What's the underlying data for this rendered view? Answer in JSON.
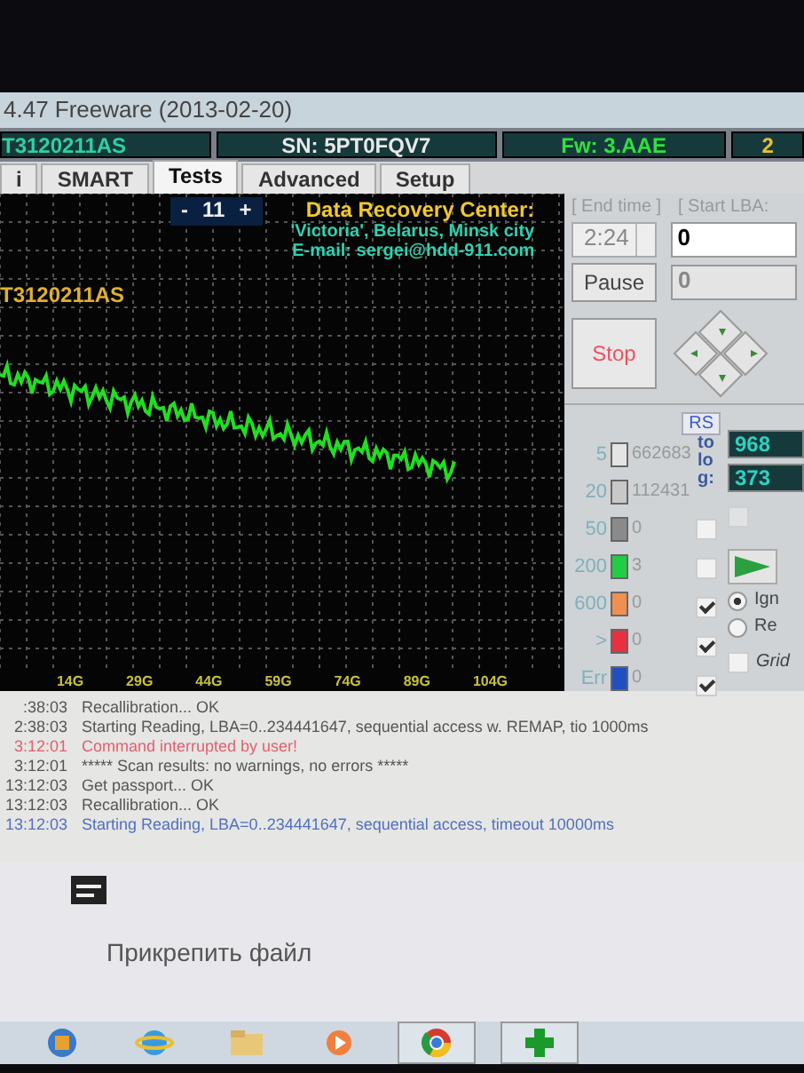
{
  "window": {
    "title": "4.47 Freeware (2013-02-20)"
  },
  "info_bar": [
    {
      "text": "T3120211AS",
      "kind": "model"
    },
    {
      "text": "SN: 5PT0FQV7",
      "kind": "serial"
    },
    {
      "text": "Fw: 3.AAE",
      "kind": "firmware"
    },
    {
      "text": "2",
      "kind": "capacity"
    }
  ],
  "tabs": [
    {
      "label": "i",
      "selected": false
    },
    {
      "label": "SMART",
      "selected": false
    },
    {
      "label": "Tests",
      "selected": true
    },
    {
      "label": "Advanced",
      "selected": false
    },
    {
      "label": "Setup",
      "selected": false
    }
  ],
  "graph": {
    "minus": "-",
    "counter": "11",
    "plus": "+",
    "credit_title": "Data Recovery Center:",
    "credit_lines": [
      "'Victoria', Belarus, Minsk city",
      "E-mail: sergei@hdd-911.com"
    ],
    "drive_label": "T3120211AS",
    "x_labels": [
      "14G",
      "29G",
      "44G",
      "59G",
      "74G",
      "89G",
      "104G"
    ]
  },
  "controls": {
    "end_time_label": "[ End time ]",
    "start_lba_label": "[ Start LBA:",
    "end_time": "2:24",
    "start_lba": "0",
    "pause": "Pause",
    "field_2": "0",
    "stop": "Stop"
  },
  "stats": {
    "rs": "RS",
    "to_log": "to log:",
    "blocks": [
      {
        "label": "5",
        "count": "662683",
        "color": "#e4e4e4"
      },
      {
        "label": "20",
        "count": "112431",
        "color": "#c8c8c8"
      },
      {
        "label": "50",
        "count": "0",
        "color": "#8a8a8a"
      },
      {
        "label": "200",
        "count": "3",
        "color": "#22cc44"
      },
      {
        "label": "600",
        "count": "0",
        "color": "#f09050"
      },
      {
        "label": ">",
        "count": "0",
        "color": "#e83040"
      },
      {
        "label": "Err",
        "count": "0",
        "color": "#2050c0"
      }
    ],
    "log_checks": [
      {
        "checked": false
      },
      {
        "checked": false
      },
      {
        "checked": true
      },
      {
        "checked": true
      },
      {
        "checked": true
      }
    ]
  },
  "side": {
    "readouts": [
      "968",
      "373"
    ],
    "option": {
      "checked": false,
      "disabled": true
    },
    "radios": [
      {
        "label": "Ign",
        "selected": true
      },
      {
        "label": "Re",
        "selected": false
      }
    ],
    "grid": {
      "label": "Grid",
      "checked": false
    }
  },
  "log": [
    {
      "time": ":38:03",
      "text": "Recallibration... OK",
      "kind": "normal"
    },
    {
      "time": "2:38:03",
      "text": "Starting Reading, LBA=0..234441647, sequential access w. REMAP, tio 1000ms",
      "kind": "normal"
    },
    {
      "time": "3:12:01",
      "text": "Command interrupted by user!",
      "kind": "error"
    },
    {
      "time": "3:12:01",
      "text": "***** Scan results: no warnings, no errors *****",
      "kind": "normal"
    },
    {
      "time": "13:12:03",
      "text": "Get passport... OK",
      "kind": "normal"
    },
    {
      "time": "13:12:03",
      "text": "Recallibration... OK",
      "kind": "normal"
    },
    {
      "time": "13:12:03",
      "text": "Starting Reading, LBA=0..234441647, sequential access, timeout 10000ms",
      "kind": "info"
    }
  ],
  "browser": {
    "attach_label": "Прикрепить файл"
  },
  "taskbar": [
    {
      "kind": "orb",
      "running": false
    },
    {
      "kind": "globe",
      "running": false
    },
    {
      "kind": "folder",
      "running": false
    },
    {
      "kind": "play",
      "running": false
    },
    {
      "kind": "wheel",
      "running": true
    },
    {
      "kind": "plus",
      "running": true
    }
  ]
}
